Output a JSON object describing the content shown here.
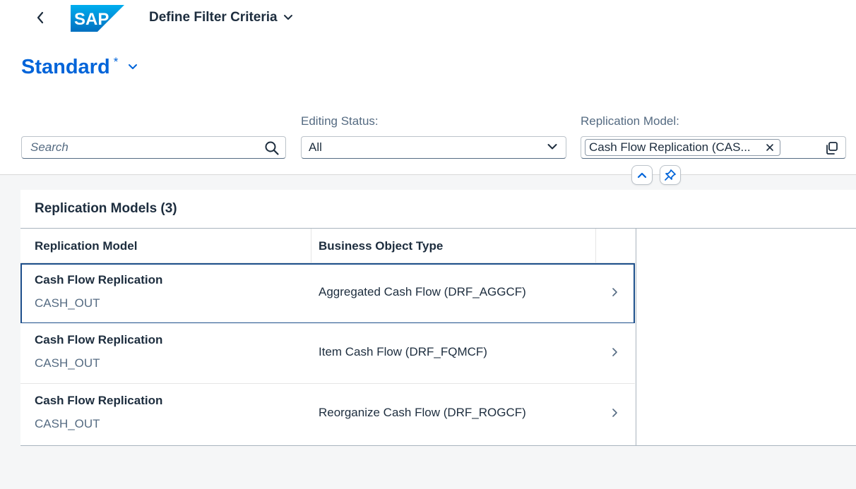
{
  "shell": {
    "app_title": "Define Filter Criteria",
    "logo_text": "SAP"
  },
  "variant": {
    "name": "Standard",
    "modified_marker": "*"
  },
  "filters": {
    "search": {
      "placeholder": "Search",
      "value": ""
    },
    "editing_status": {
      "label": "Editing Status:",
      "value": "All"
    },
    "replication_model": {
      "label": "Replication Model:",
      "token": "Cash Flow Replication (CAS..."
    }
  },
  "table": {
    "title": "Replication Models (3)",
    "columns": [
      "Replication Model",
      "Business Object Type"
    ],
    "rows": [
      {
        "name": "Cash Flow Replication",
        "id": "CASH_OUT",
        "bo_type": "Aggregated Cash Flow (DRF_AGGCF)"
      },
      {
        "name": "Cash Flow Replication",
        "id": "CASH_OUT",
        "bo_type": "Item Cash Flow (DRF_FQMCF)"
      },
      {
        "name": "Cash Flow Replication",
        "id": "CASH_OUT",
        "bo_type": "Reorganize Cash Flow (DRF_ROGCF)"
      }
    ]
  },
  "colors": {
    "brand_blue": "#0064d9",
    "text": "#1d2d3e",
    "secondary_text": "#556b82",
    "focus_border": "#1d4f8b"
  },
  "icons": [
    "back-arrow-icon",
    "chevron-down-icon",
    "search-icon",
    "close-icon",
    "value-help-icon",
    "chevron-up-icon",
    "pin-icon",
    "chevron-right-icon"
  ]
}
